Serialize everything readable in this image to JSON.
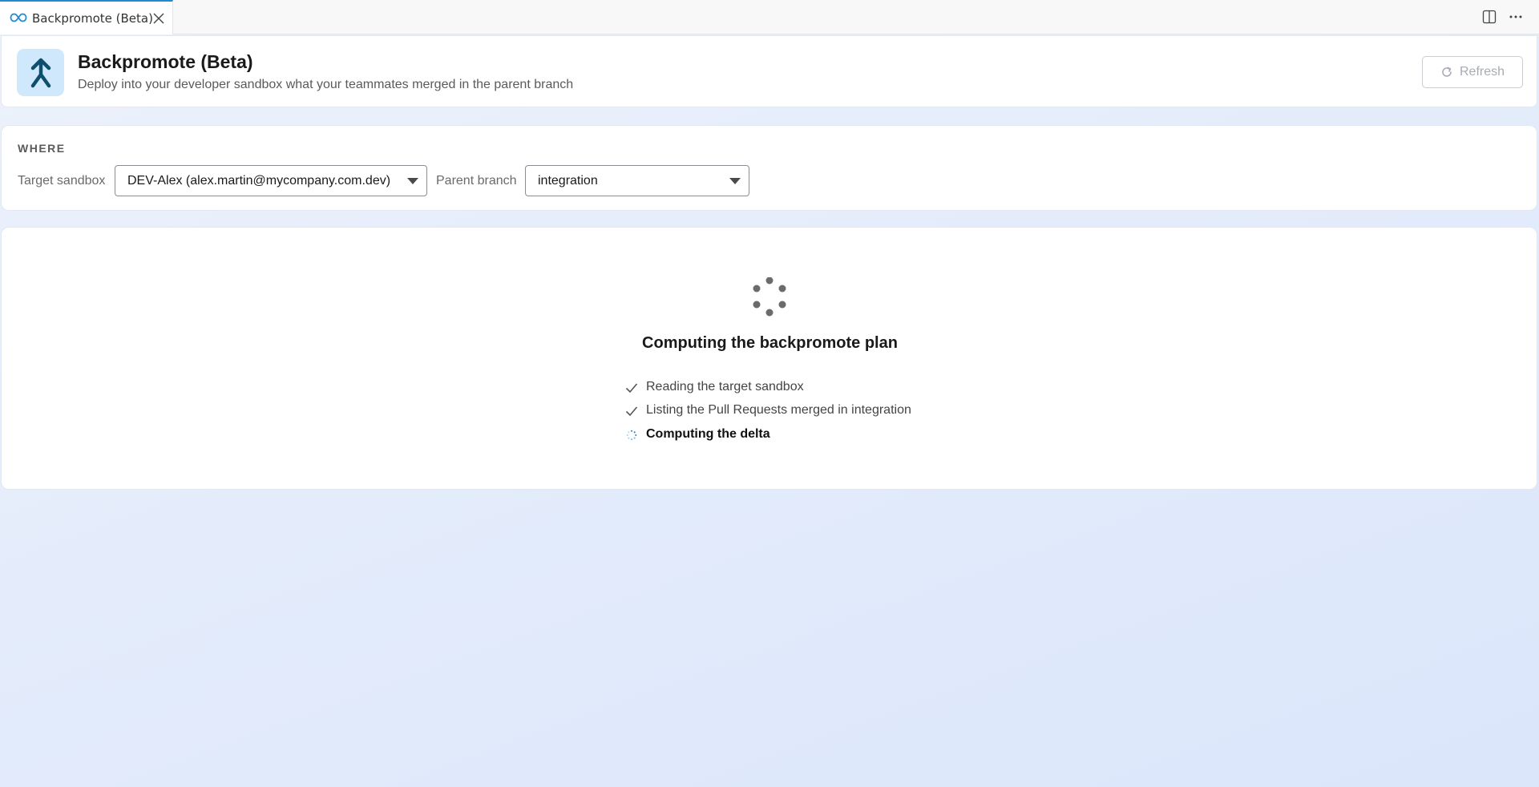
{
  "tab": {
    "label": "Backpromote (Beta)"
  },
  "header": {
    "title": "Backpromote (Beta)",
    "subtitle": "Deploy into your developer sandbox what your teammates merged in the parent branch",
    "refresh_label": "Refresh",
    "logo_icon": "merge-up-arrow-icon"
  },
  "where": {
    "heading": "WHERE",
    "target_sandbox_label": "Target sandbox",
    "target_sandbox_value": "DEV-Alex (alex.martin@mycompany.com.dev)",
    "parent_branch_label": "Parent branch",
    "parent_branch_value": "integration"
  },
  "progress": {
    "title": "Computing the backpromote plan",
    "steps": [
      {
        "label": "Reading the target sandbox",
        "status": "done"
      },
      {
        "label": "Listing the Pull Requests merged in integration",
        "status": "done"
      },
      {
        "label": "Computing the delta",
        "status": "in-progress"
      }
    ]
  },
  "colors": {
    "accent": "#1f8ad2",
    "logo_bg": "#cfe8fb",
    "logo_fg": "#0f4f6e"
  }
}
